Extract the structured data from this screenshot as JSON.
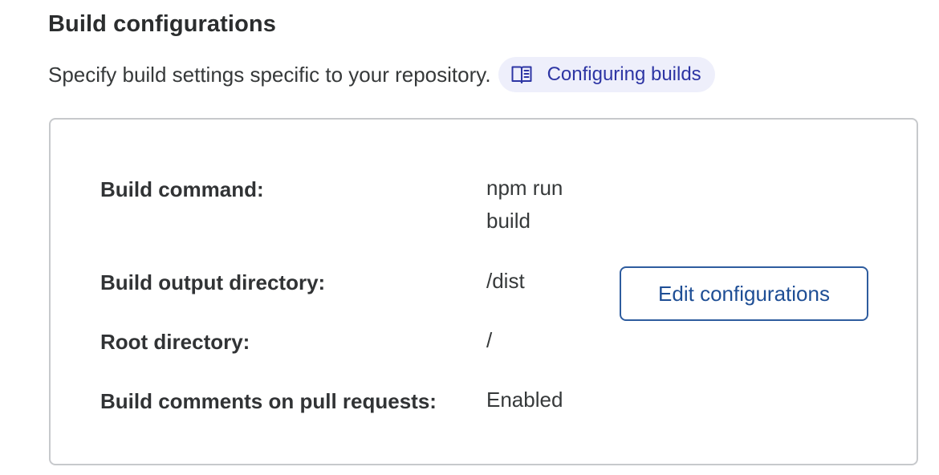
{
  "section": {
    "title": "Build configurations",
    "description": "Specify build settings specific to your repository.",
    "docs_link": {
      "icon": "book-icon",
      "label": "Configuring builds"
    }
  },
  "config": {
    "rows": [
      {
        "label": "Build command:",
        "value": "npm run build"
      },
      {
        "label": "Build output directory:",
        "value": "/dist"
      },
      {
        "label": "Root directory:",
        "value": "/"
      },
      {
        "label": "Build comments on pull requests:",
        "value": "Enabled"
      }
    ],
    "edit_button_label": "Edit configurations"
  },
  "colors": {
    "accent": "#2d35a4",
    "link_background": "#eeeffb",
    "button_border": "#2e5c9e",
    "card_border": "#c7c9cc"
  }
}
